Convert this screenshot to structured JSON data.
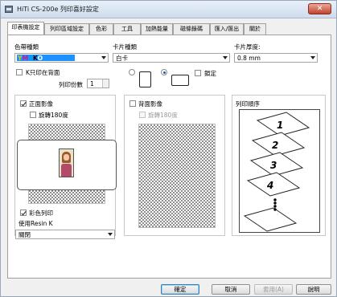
{
  "window": {
    "title": "HiTi CS-200e 列印喜好設定",
    "close_label": "✕"
  },
  "tabs": [
    {
      "label": "印表機設定",
      "active": true
    },
    {
      "label": "列印區域設定",
      "active": false
    },
    {
      "label": "色彩",
      "active": false
    },
    {
      "label": "工具",
      "active": false
    },
    {
      "label": "加熱能量",
      "active": false
    },
    {
      "label": "磁條錄碼",
      "active": false
    },
    {
      "label": "匯入/匯出",
      "active": false
    },
    {
      "label": "關於",
      "active": false
    }
  ],
  "ribbon": {
    "label": "色帶種類",
    "value": "YMCKO",
    "colors": {
      "Y": "#f2e600",
      "M": "#d4148c",
      "C": "#00a3e0",
      "K": "#000000",
      "O": "#ffffff",
      "selection": "#1e90ff"
    }
  },
  "card_type": {
    "label": "卡片種類",
    "value": "白卡"
  },
  "card_thickness": {
    "label": "卡片厚度:",
    "value": "0.8 mm"
  },
  "k_back": {
    "label": "K只印在背面",
    "checked": false
  },
  "orientation": {
    "portrait_selected": false,
    "landscape_selected": true,
    "lock_label": "鎖定",
    "lock_checked": false
  },
  "copies": {
    "label": "列印份數",
    "value": "1"
  },
  "front": {
    "label": "正面影像",
    "checked": true,
    "rotate_label": "旋轉180度",
    "rotate_checked": false,
    "color_print_label": "彩色列印",
    "color_print_checked": true,
    "resin_label": "使用Resin K",
    "resin_value": "關閉"
  },
  "back": {
    "label": "背面影像",
    "checked": false,
    "rotate_label": "旋轉180度",
    "rotate_checked": false
  },
  "print_order": {
    "label": "列印順序",
    "cards": [
      "1",
      "2",
      "3",
      "4"
    ]
  },
  "buttons": {
    "ok": "確定",
    "cancel": "取消",
    "apply": "套用(A)",
    "help": "說明"
  }
}
